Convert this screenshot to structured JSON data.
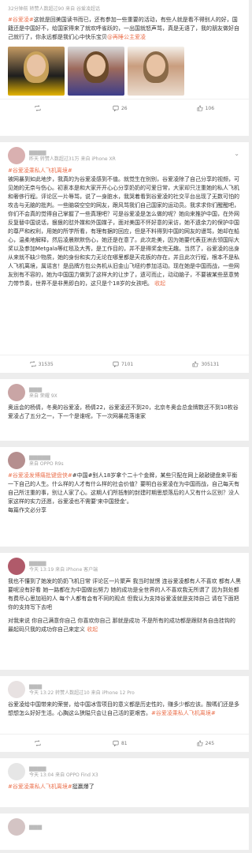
{
  "posts": [
    {
      "meta": "32分钟前 转赞人数超过90  来自 谷爱凌超话",
      "text_main": "这就是回美国读书而已，还有参加一些重要的活动，有些人就是看不得别人的好，国籍还是中国好不，给国家得来了就欢呼雀跃的，一出国就怒声骂，真是无语了，我的朋友做好自己就行了，你永远都是我们心中快乐宝贝",
      "tag": "#谷爱凌#",
      "mention": "@再睡公主爱凌",
      "stats": {
        "repost": "",
        "comment": "26",
        "like": "106"
      }
    },
    {
      "meta": "昨天 转赞人数超过31万  来自 iPhone XR",
      "tag": "#谷爱凌乘私人飞机离境#",
      "text_main": "被网暴到如此地步，我真的为谷爱凌感到不值。就觉生在别别，谷爱凌除了自己分享的视频，可见她的无奈与伤心。初衷本是和大家开开心心分享奶奶的可爱日常，大家却只注重她的私人飞机和奢侈行程。评论区一片辱骂，说了一身脏水，我哭着看到谷爱凌的社交平台出现了无数可怕的攻击与无脑的批判。一些脑袋空空的网友，跟风骂我们自己国家的运动员。我求求你们醒醒吧，你们不会真的觉得自己掌握了一些真理吧？可是谷爱凌是怎么做的呢？她向来推护中国，在外网反复替中国说话，狠狠的怼外媒和外国媒子，面对美国不怀好意的采访，她不遗余力的保护中国的尊严和权利，用她的所学所看，有理有据的回应，但是不料得到中国的网友的谩骂，她却在船心，温柔地解释，然后凌晨默默伤心，她还是在意了。此次赴美，因为她要代表亚洲去领国际大奖以及参加Metgala等红毯及大秀，是工作目的，并不是得奖金完无趣。当然了，谷爱凌的出身从来就不缺少物质，她的身份和实力无论在哪里都是天花板的存在，并且此次行程，根本不是私人飞机离境，属谣言！是品牌方包公务机从旧金山飞纽约参加活动。现在她是中国而战，一些网友别有不容的，她为中国国力做到了这样大的让步了，遗可而止，动动脑子，不要被某些恶意势力带节奏，世界不是非黑即白的，这只是个18岁的女孩吧。",
      "collapse": "收起",
      "stats": {
        "repost": "31535",
        "comment": "7101",
        "like": "305131"
      }
    },
    {
      "meta": "来自 荣耀 9X",
      "text_main": "奥运会的杨倩，冬奥的谷爱凌，杨倩22，谷爱凌还不到20，北京冬奥会总金牌数还不到10枚谷爱凌占了五分之一，下一个是谁呢，下一次网暴花落谁家",
      "stats": {
        "repost": "",
        "comment": "",
        "like": ""
      }
    },
    {
      "meta": "来自 OPPO R9s",
      "tag": "#谷爱凌发博痛批键盘侠#",
      "text_main": "#中国#别人18岁拿个二十个金牌，某些只配在网上敲敲键盘来平衡一下自己的人生。什么样的人才有什么样的社会价值？要明白谷爱凌在为中国而战，自己每天有自己所注重的事，别让人家了心。这期人们所抵制的封建时期思想落后的人又有什么区别？没人家这样的实力还愿，谷爱凌也不需要'来中国授金'。",
      "footer": "每篇作文必分享",
      "stats": {
        "repost": "",
        "comment": "",
        "like": ""
      }
    },
    {
      "meta": "今天 13:19  来自 iPhone 客户端",
      "text_main": "我也不懂到了她发的奶奶飞机日常 评论区一片聚声 我当时就愣 连谷爱凌都有人不喜欢 都有人黑 要呢没有好看 她一路都在为中国做出努力 她的成功是全世界的人不喜欢我无所谓了 因为到处都有费尽心思加班的人 每个人都有会有不同的观点 但我认为支持谷爱凌就是支持自己 请在下面把你的支持写下去吧",
      "text_extra": "对我来说 你自己满意你自己 你喜欢你自己 那就是成功 不是所有的成功都是跟财务自由挂钩的 最起码只我的成功你自己来定义",
      "collapse": "收起",
      "stats": {
        "repost": "",
        "comment": "",
        "like": ""
      }
    },
    {
      "meta": "今天 13:22  转赞人数超过10  来自 iPhone 12 Pro",
      "text_main": "谷爱凌给中国带来的荣誉，给中国冰雪项目的意义都是历史性的，赚多少都应该。酸嗎们还是多想想怎么好好生活。心胸这么狭隘只会让自己活的更艰苦。",
      "tag": "#谷爱凌乘私人飞机离境#",
      "stats": {
        "repost": "",
        "comment": "81",
        "like": "245"
      }
    },
    {
      "meta": "今天 13:04  来自 OPPO Find X3",
      "tag": "#谷爱凌乘私人飞机离境#",
      "text_main": "挺赢爆了",
      "stats": {
        "repost": "",
        "comment": "",
        "like": ""
      }
    }
  ]
}
